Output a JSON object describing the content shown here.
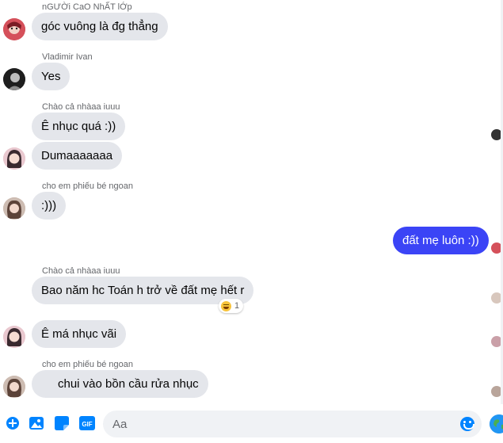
{
  "colors": {
    "incoming_bubble": "#e4e6eb",
    "outgoing_bubble": "#3b44f6",
    "accent": "#0084ff",
    "sender_name": "#65676b"
  },
  "messages": [
    {
      "sender": "nGƯỜi CaO NhẤT lỚp",
      "text": "góc vuông là đg thẳng",
      "avatar": "avatar-red-icon"
    },
    {
      "sender": "Vladimir Ivan",
      "text": "Yes",
      "avatar": "avatar-dark-icon"
    },
    {
      "sender": "Chào cả nhàaa iuuu",
      "text": "Ê nhục quá :))"
    },
    {
      "text": "Dumaaaaaaa",
      "avatar": "avatar-girl-icon"
    },
    {
      "sender": "cho em phiếu bé ngoan",
      "text": ":)))",
      "avatar": "avatar-girl2-icon"
    },
    {
      "text": "đất mẹ luôn :))",
      "outgoing": true
    },
    {
      "sender": "Chào cả nhàaa iuuu",
      "text": "Bao năm hc Toán h trở về đất mẹ hết r",
      "reaction": {
        "emoji": "laughing-emoji-icon",
        "count": "1"
      }
    },
    {
      "text": "Ê má nhục vãi",
      "avatar": "avatar-girl-icon"
    },
    {
      "sender": "cho em phiếu bé ngoan",
      "text": "chui vào bồn cầu rửa nhục",
      "avatar": "avatar-girl2-icon"
    }
  ],
  "composer": {
    "placeholder": "Aa",
    "tools": [
      "plus-circle-icon",
      "image-icon",
      "sticker-icon",
      "gif-icon"
    ],
    "gif_label": "GIF"
  }
}
